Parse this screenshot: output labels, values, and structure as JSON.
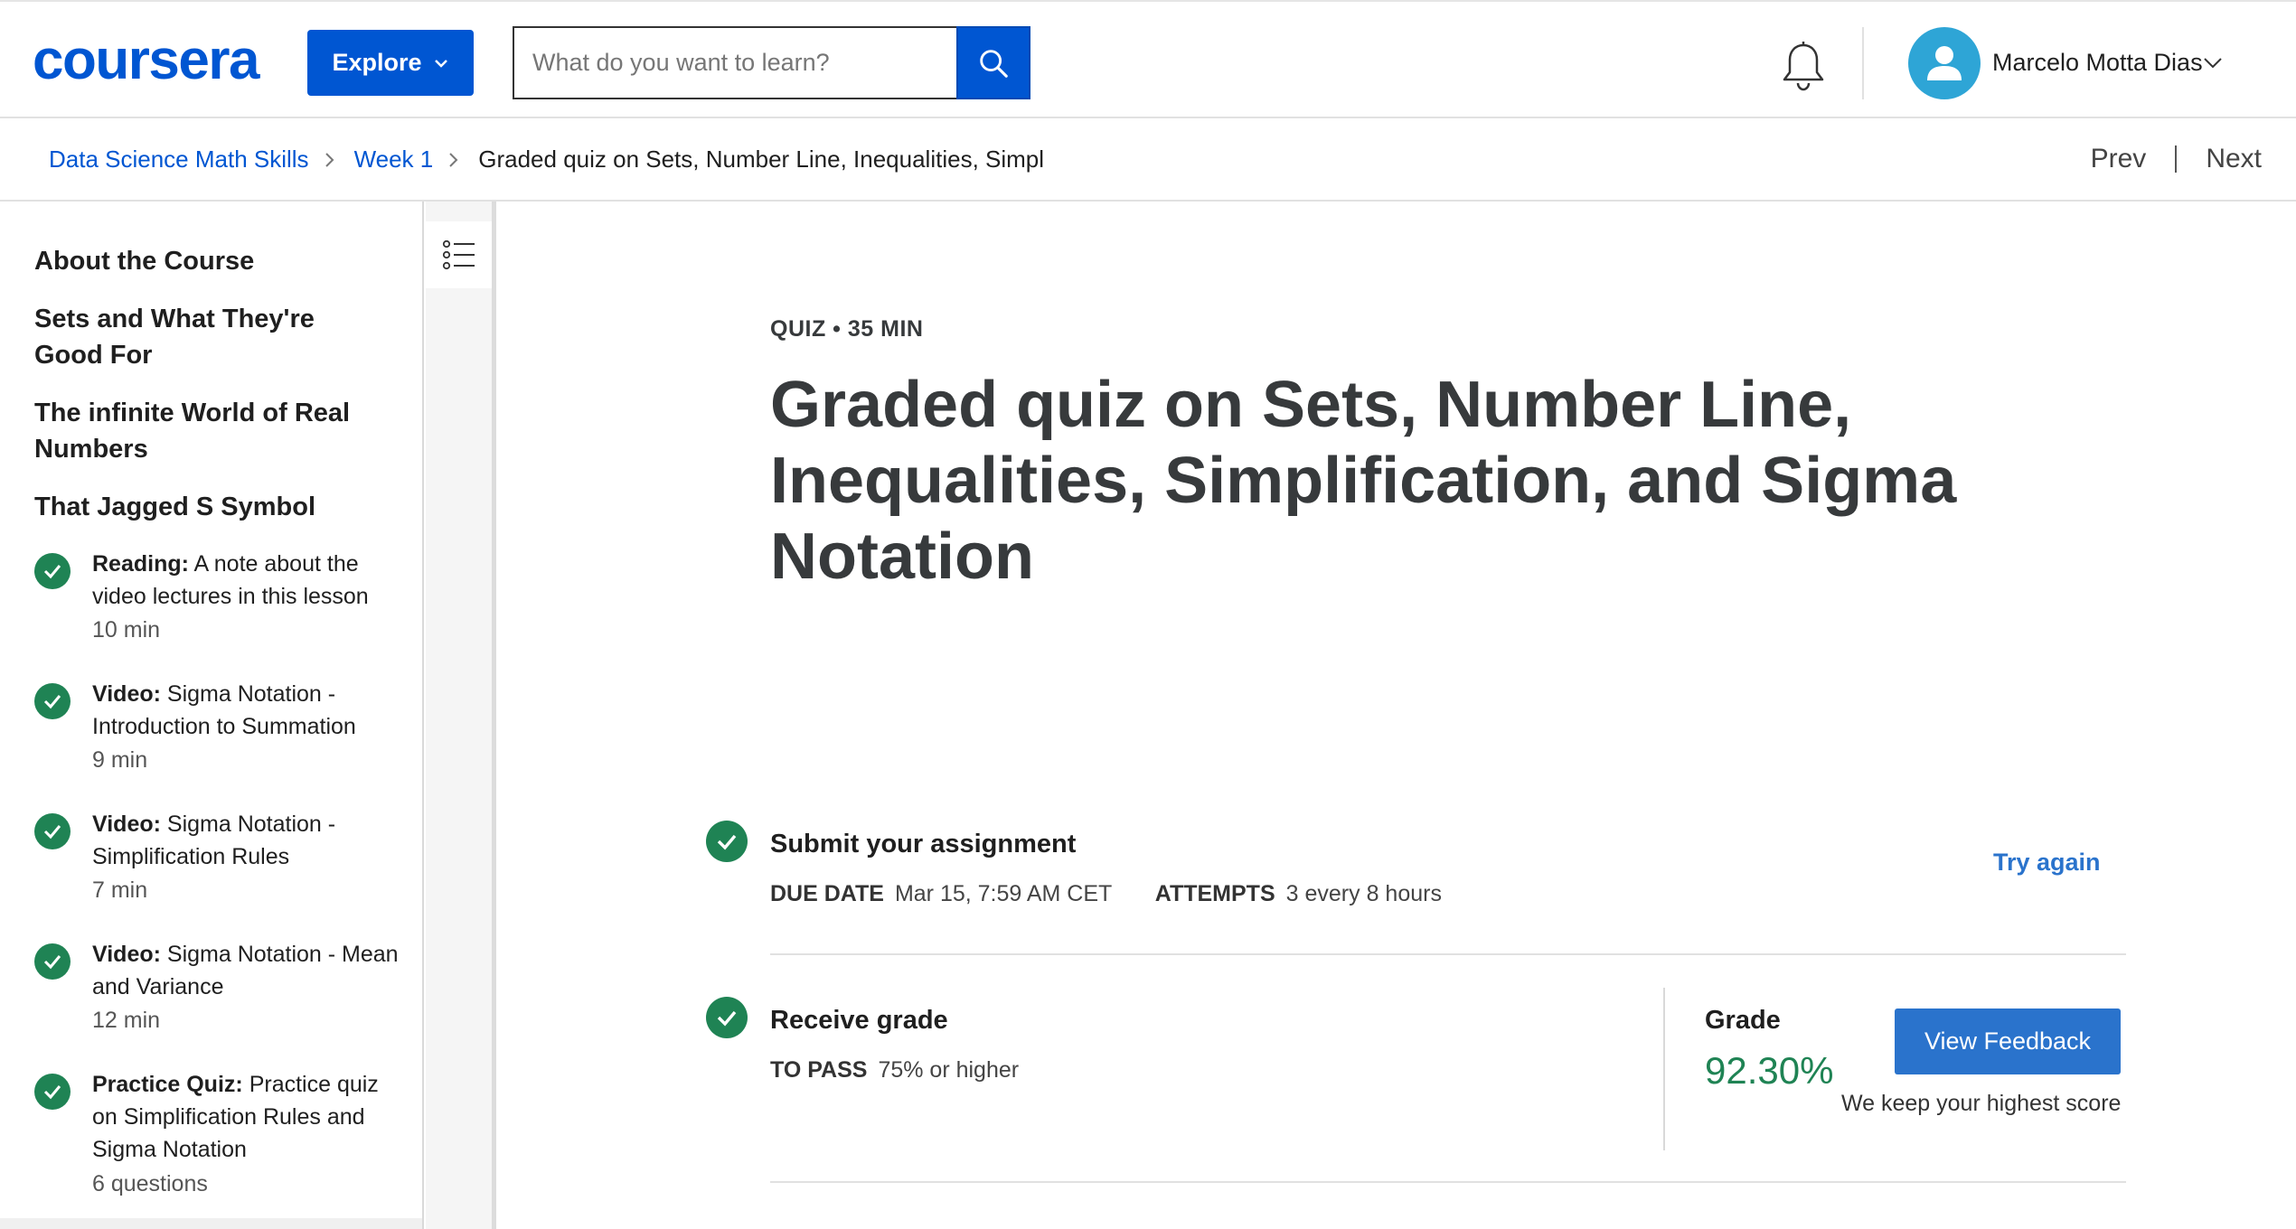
{
  "header": {
    "logo": "coursera",
    "explore_label": "Explore",
    "search_placeholder": "What do you want to learn?",
    "user_name": "Marcelo Motta Dias"
  },
  "breadcrumb": {
    "items": [
      "Data Science Math Skills",
      "Week 1"
    ],
    "current": "Graded quiz on Sets, Number Line, Inequalities, Simpl",
    "prev_label": "Prev",
    "next_label": "Next"
  },
  "sidebar": {
    "headings": [
      "About the Course",
      "Sets and What They're Good For",
      "The infinite World of Real Numbers",
      "That Jagged S Symbol"
    ],
    "items": [
      {
        "type": "Reading:",
        "title": "A note about the video lectures in this lesson",
        "meta": "10 min"
      },
      {
        "type": "Video:",
        "title": "Sigma Notation - Introduction to Summation",
        "meta": "9 min"
      },
      {
        "type": "Video:",
        "title": "Sigma Notation - Simplification Rules",
        "meta": "7 min"
      },
      {
        "type": "Video:",
        "title": "Sigma Notation - Mean and Variance",
        "meta": "12 min"
      },
      {
        "type": "Practice Quiz:",
        "title": "Practice quiz on Simplification Rules and Sigma Notation",
        "meta": "6 questions"
      }
    ]
  },
  "main": {
    "meta": "QUIZ • 35 MIN",
    "title": "Graded quiz on Sets, Number Line, Inequalities, Simplification, and Sigma Notation",
    "submit": {
      "title": "Submit your assignment",
      "due_label": "DUE DATE",
      "due_value": "Mar 15, 7:59 AM CET",
      "attempts_label": "ATTEMPTS",
      "attempts_value": "3 every 8 hours",
      "try_again": "Try again"
    },
    "grade": {
      "title": "Receive grade",
      "pass_label": "TO PASS",
      "pass_value": "75% or higher",
      "grade_label": "Grade",
      "grade_value": "92.30%",
      "feedback_button": "View Feedback",
      "note": "We keep your highest score"
    }
  },
  "colors": {
    "brand": "#0056d2",
    "success": "#1f8354",
    "link": "#2a73cc"
  }
}
